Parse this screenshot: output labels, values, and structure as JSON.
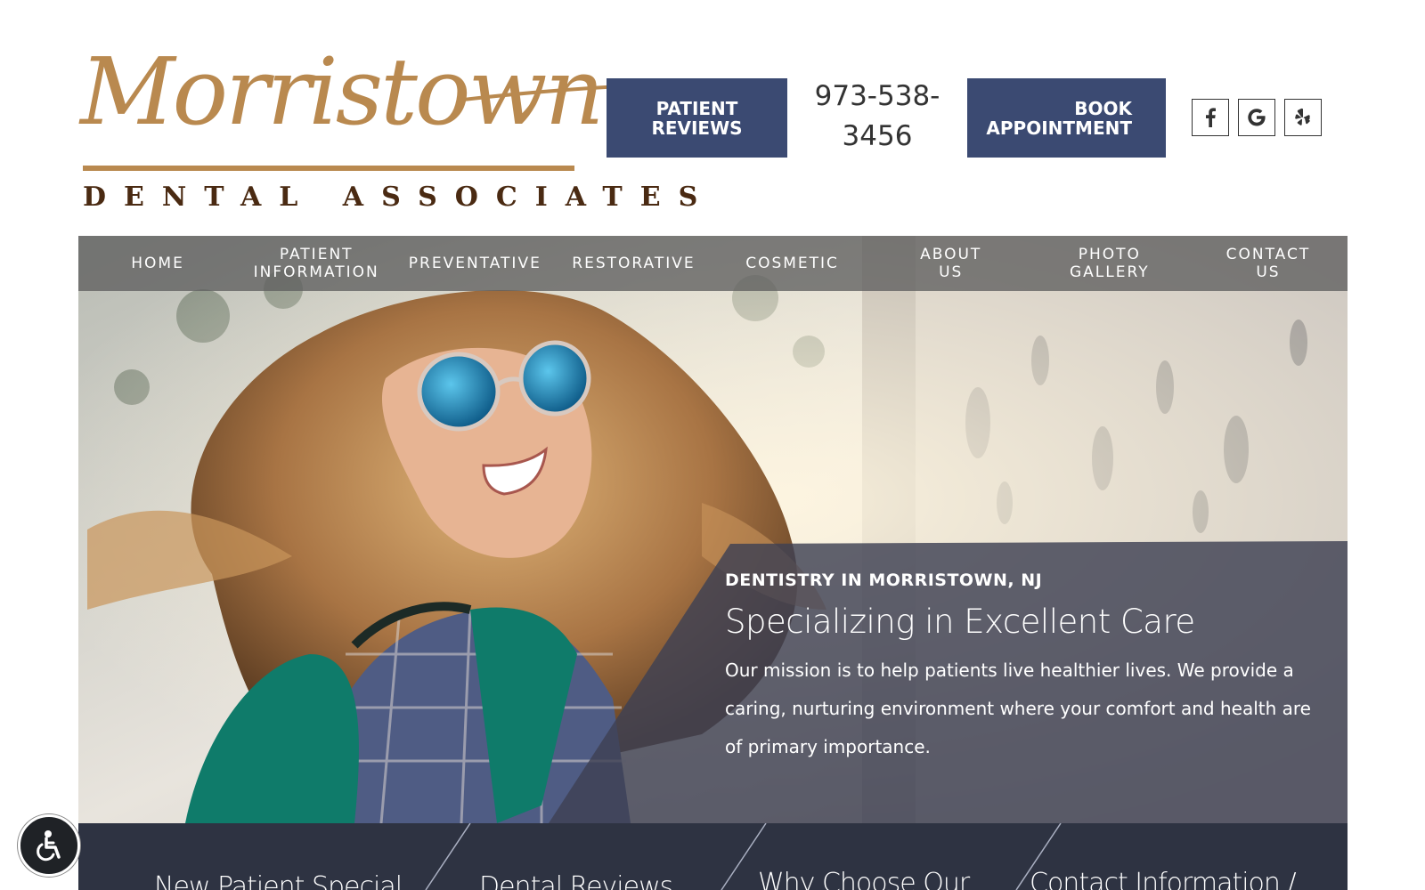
{
  "logo": {
    "script_text": "Morristown",
    "sub_text": "DENTAL ASSOCIATES"
  },
  "header": {
    "reviews_button": "PATIENT REVIEWS",
    "phone": "973-538-3456",
    "book_button": "BOOK APPOINTMENT",
    "social": [
      {
        "name": "facebook-icon",
        "glyph": "f"
      },
      {
        "name": "google-icon",
        "glyph": "G"
      },
      {
        "name": "yelp-icon",
        "glyph": "✻"
      }
    ]
  },
  "nav": {
    "items": [
      {
        "label": "HOME"
      },
      {
        "label": "PATIENT\nINFORMATION"
      },
      {
        "label": "PREVENTATIVE"
      },
      {
        "label": "RESTORATIVE"
      },
      {
        "label": "COSMETIC"
      },
      {
        "label": "ABOUT\nUS"
      },
      {
        "label": "PHOTO\nGALLERY"
      },
      {
        "label": "CONTACT\nUS"
      }
    ]
  },
  "hero": {
    "kicker": "DENTISTRY IN MORRISTOWN, NJ",
    "title": "Specializing in Excellent Care",
    "body": "Our mission is to help patients live healthier lives. We provide a caring, nurturing environment where your comfort and health are of primary importance."
  },
  "band": {
    "items": [
      {
        "label": "New Patient Special"
      },
      {
        "label": "Dental Reviews"
      },
      {
        "label": "Why Choose Our"
      },
      {
        "label": "Contact Information /"
      }
    ]
  },
  "colors": {
    "brand_gold": "#b9894f",
    "brand_brown": "#4a2a12",
    "button_navy": "#3b4a72",
    "band_dark": "#2e3342"
  }
}
